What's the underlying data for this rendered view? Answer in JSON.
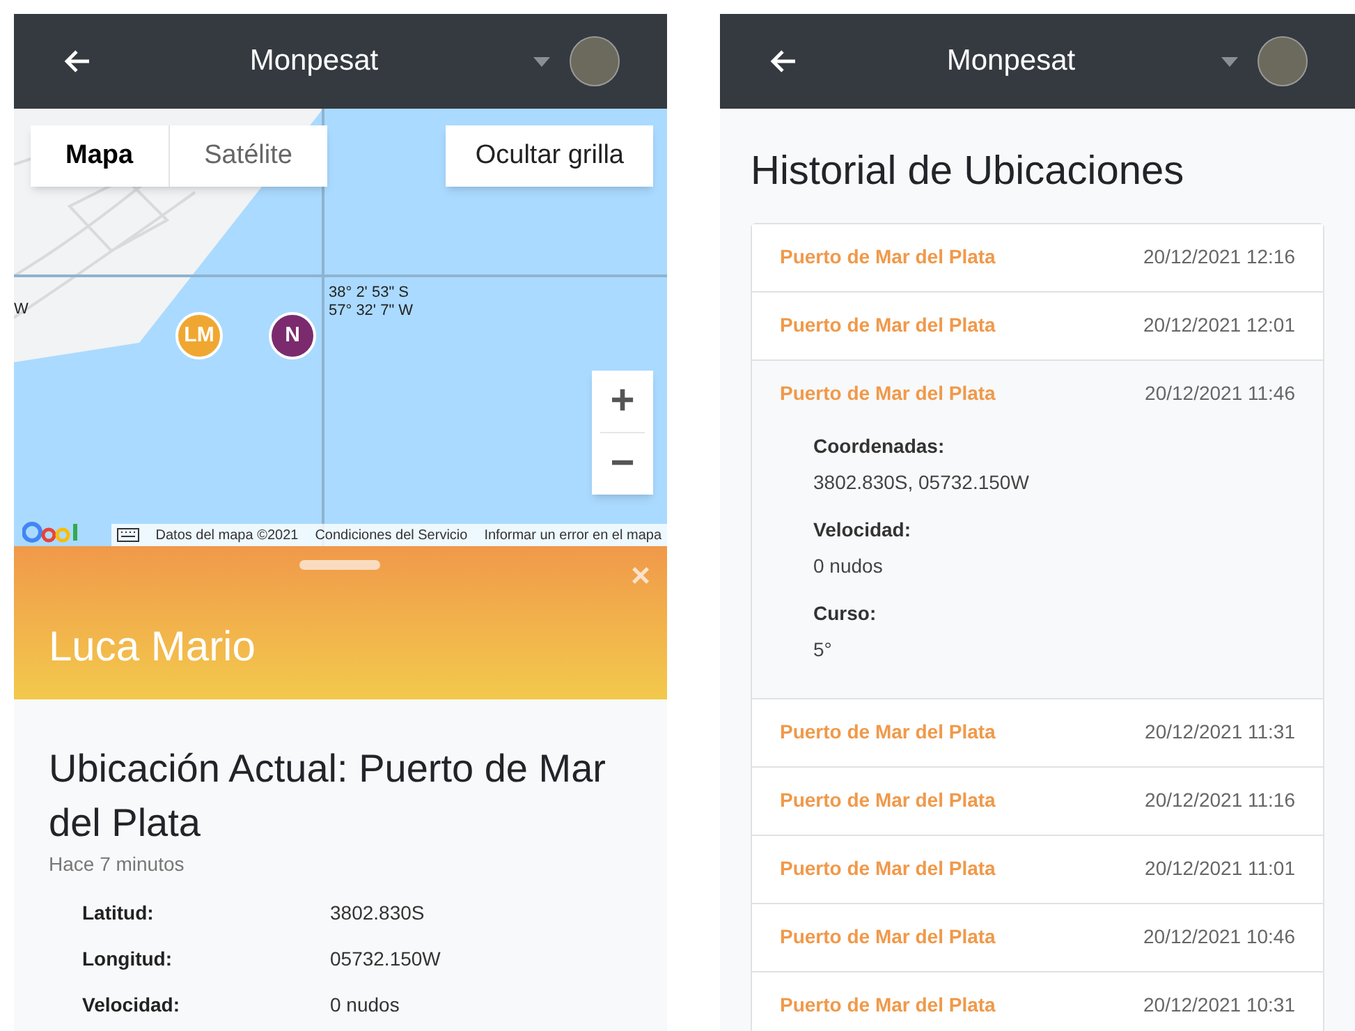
{
  "left_screen": {
    "app_bar": {
      "title": "Monpesat"
    },
    "map": {
      "map_types": [
        {
          "label": "Mapa",
          "selected": true
        },
        {
          "label": "Satélite",
          "selected": false
        }
      ],
      "grid_button": "Ocultar grilla",
      "grid_label_edge": "W",
      "grid_label": [
        "38° 2' 53\" S",
        "57° 32' 7\" W"
      ],
      "markers": [
        {
          "label": "LM",
          "color": "#f0a732"
        },
        {
          "label": "N",
          "color": "#7b2a6e"
        }
      ],
      "zoom_in": "+",
      "zoom_out": "−",
      "footer": [
        "Datos del mapa ©2021",
        "Condiciones del Servicio",
        "Informar un error en el mapa"
      ]
    },
    "sheet": {
      "close": "×",
      "name": "Luca Mario",
      "heading": "Ubicación Actual: Puerto de Mar del Plata",
      "time_ago": "Hace 7 minutos",
      "details": [
        {
          "label": "Latitud:",
          "value": "3802.830S"
        },
        {
          "label": "Longitud:",
          "value": "05732.150W"
        },
        {
          "label": "Velocidad:",
          "value": "0 nudos"
        }
      ]
    }
  },
  "right_screen": {
    "app_bar": {
      "title": "Monpesat"
    },
    "title": "Historial de Ubicaciones",
    "history": [
      {
        "place": "Puerto de Mar del Plata",
        "time": "20/12/2021 12:16",
        "expanded": false
      },
      {
        "place": "Puerto de Mar del Plata",
        "time": "20/12/2021 12:01",
        "expanded": false
      },
      {
        "place": "Puerto de Mar del Plata",
        "time": "20/12/2021 11:46",
        "expanded": true,
        "details": [
          {
            "label": "Coordenadas:",
            "value": "3802.830S, 05732.150W"
          },
          {
            "label": "Velocidad:",
            "value": "0 nudos"
          },
          {
            "label": "Curso:",
            "value": "5°"
          }
        ]
      },
      {
        "place": "Puerto de Mar del Plata",
        "time": "20/12/2021 11:31",
        "expanded": false
      },
      {
        "place": "Puerto de Mar del Plata",
        "time": "20/12/2021 11:16",
        "expanded": false
      },
      {
        "place": "Puerto de Mar del Plata",
        "time": "20/12/2021 11:01",
        "expanded": false
      },
      {
        "place": "Puerto de Mar del Plata",
        "time": "20/12/2021 10:46",
        "expanded": false
      },
      {
        "place": "Puerto de Mar del Plata",
        "time": "20/12/2021 10:31",
        "expanded": false
      }
    ]
  }
}
